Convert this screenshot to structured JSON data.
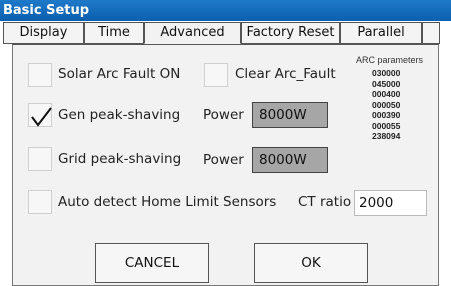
{
  "window": {
    "title": "Basic Setup"
  },
  "tabs": [
    {
      "label": "Display"
    },
    {
      "label": "Time"
    },
    {
      "label": "Advanced"
    },
    {
      "label": "Factory Reset"
    },
    {
      "label": "Parallel"
    }
  ],
  "active_tab": "Advanced",
  "options": {
    "solar_arc_fault": {
      "label": "Solar Arc Fault ON",
      "checked": false
    },
    "clear_arc_fault": {
      "label": "Clear Arc_Fault",
      "checked": false
    },
    "gen_peak_shaving": {
      "label": "Gen peak-shaving",
      "checked": true,
      "power_label": "Power",
      "power_value": "8000W"
    },
    "grid_peak_shaving": {
      "label": "Grid peak-shaving",
      "checked": false,
      "power_label": "Power",
      "power_value": "8000W"
    },
    "auto_detect": {
      "label": "Auto detect Home Limit Sensors",
      "checked": false
    }
  },
  "ct_ratio": {
    "label": "CT ratio",
    "value": "2000"
  },
  "arc_parameters": {
    "title": "ARC parameters",
    "values": [
      "030000",
      "045000",
      "000400",
      "000050",
      "000390",
      "000055",
      "238094"
    ]
  },
  "buttons": {
    "cancel": "CANCEL",
    "ok": "OK"
  },
  "colors": {
    "titlebar": "#0b5fae",
    "panel": "#f2f2f2",
    "value_box": "#a6a6a6"
  }
}
